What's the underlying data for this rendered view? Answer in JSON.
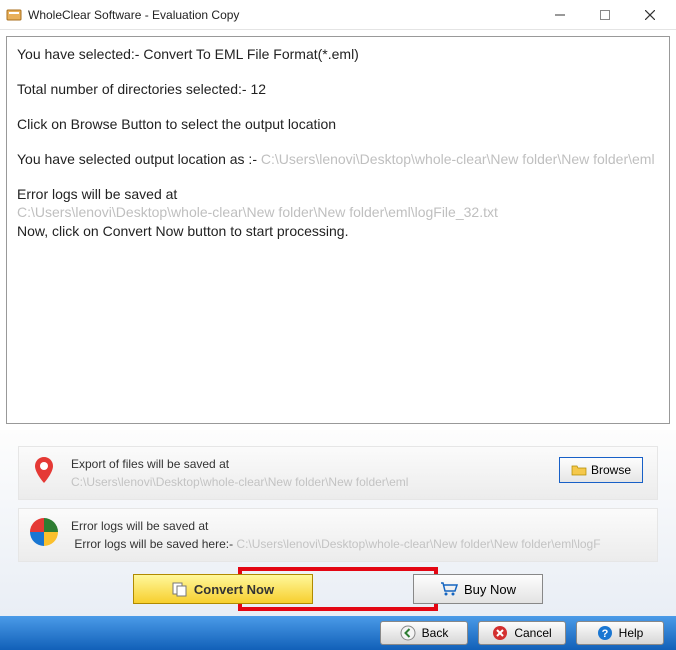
{
  "titlebar": {
    "title": "WholeClear Software - Evaluation Copy"
  },
  "log": {
    "line1": "You have selected:- Convert To EML File Format(*.eml)",
    "line2": "Total number of directories selected:- 12",
    "line3": "Click on Browse Button to select the output location",
    "line4a": "You have selected output location as :- ",
    "line4b": "C:\\Users\\lenovi\\Desktop\\whole-clear\\New folder\\New folder\\eml",
    "line5": "Error logs will be saved at",
    "line5path": "C:\\Users\\lenovi\\Desktop\\whole-clear\\New folder\\New folder\\eml\\logFile_32.txt",
    "line6": "Now, click on Convert Now button to start processing."
  },
  "export": {
    "label": "Export of files will be saved at",
    "path": "C:\\Users\\lenovi\\Desktop\\whole-clear\\New folder\\New folder\\eml",
    "browse": "Browse"
  },
  "errors": {
    "label": "Error logs will be saved at",
    "prefix": "Error logs will be saved here:- ",
    "path": "C:\\Users\\lenovi\\Desktop\\whole-clear\\New folder\\New folder\\eml\\logF"
  },
  "actions": {
    "convert": "Convert Now",
    "buy": "Buy Now"
  },
  "nav": {
    "back": "Back",
    "cancel": "Cancel",
    "help": "Help"
  }
}
